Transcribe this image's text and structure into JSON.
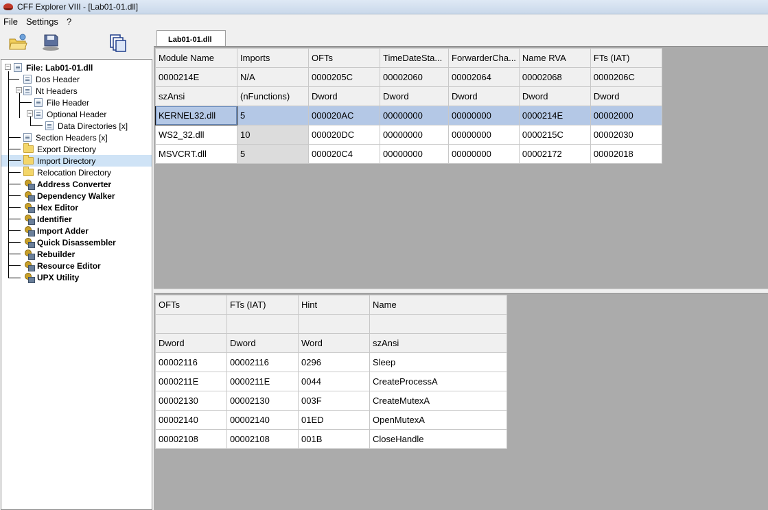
{
  "window": {
    "title": "CFF Explorer VIII - [Lab01-01.dll]"
  },
  "menu": [
    "File",
    "Settings",
    "?"
  ],
  "toolbar": {
    "buttons": [
      "open-icon",
      "save-icon",
      "windows-icon"
    ]
  },
  "tree": {
    "root": "File: Lab01-01.dll",
    "items": [
      {
        "label": "Dos Header",
        "kind": "doc"
      },
      {
        "label": "Nt Headers",
        "kind": "doc"
      },
      {
        "label": "File Header",
        "kind": "doc"
      },
      {
        "label": "Optional Header",
        "kind": "doc"
      },
      {
        "label": "Data Directories [x]",
        "kind": "doc"
      },
      {
        "label": "Section Headers [x]",
        "kind": "doc"
      },
      {
        "label": "Export Directory",
        "kind": "folder"
      },
      {
        "label": "Import Directory",
        "kind": "folder",
        "selected": true
      },
      {
        "label": "Relocation Directory",
        "kind": "folder"
      },
      {
        "label": "Address Converter",
        "kind": "tool"
      },
      {
        "label": "Dependency Walker",
        "kind": "tool"
      },
      {
        "label": "Hex Editor",
        "kind": "tool"
      },
      {
        "label": "Identifier",
        "kind": "tool"
      },
      {
        "label": "Import Adder",
        "kind": "tool"
      },
      {
        "label": "Quick Disassembler",
        "kind": "tool"
      },
      {
        "label": "Rebuilder",
        "kind": "tool"
      },
      {
        "label": "Resource Editor",
        "kind": "tool"
      },
      {
        "label": "UPX Utility",
        "kind": "tool"
      }
    ]
  },
  "tab": {
    "label": "Lab01-01.dll"
  },
  "modules": {
    "headers": [
      "Module Name",
      "Imports",
      "OFTs",
      "TimeDateSta...",
      "ForwarderCha...",
      "Name RVA",
      "FTs (IAT)"
    ],
    "offsets": [
      "0000214E",
      "N/A",
      "0000205C",
      "00002060",
      "00002064",
      "00002068",
      "0000206C"
    ],
    "types": [
      "szAnsi",
      "(nFunctions)",
      "Dword",
      "Dword",
      "Dword",
      "Dword",
      "Dword"
    ],
    "rows": [
      [
        "KERNEL32.dll",
        "5",
        "000020AC",
        "00000000",
        "00000000",
        "0000214E",
        "00002000"
      ],
      [
        "WS2_32.dll",
        "10",
        "000020DC",
        "00000000",
        "00000000",
        "0000215C",
        "00002030"
      ],
      [
        "MSVCRT.dll",
        "5",
        "000020C4",
        "00000000",
        "00000000",
        "00002172",
        "00002018"
      ]
    ],
    "selected_row": 0
  },
  "functions": {
    "headers": [
      "OFTs",
      "FTs (IAT)",
      "Hint",
      "Name"
    ],
    "offsets": [
      "",
      "",
      "",
      ""
    ],
    "types": [
      "Dword",
      "Dword",
      "Word",
      "szAnsi"
    ],
    "rows": [
      [
        "00002116",
        "00002116",
        "0296",
        "Sleep"
      ],
      [
        "0000211E",
        "0000211E",
        "0044",
        "CreateProcessA"
      ],
      [
        "00002130",
        "00002130",
        "003F",
        "CreateMutexA"
      ],
      [
        "00002140",
        "00002140",
        "01ED",
        "OpenMutexA"
      ],
      [
        "00002108",
        "00002108",
        "001B",
        "CloseHandle"
      ]
    ]
  }
}
